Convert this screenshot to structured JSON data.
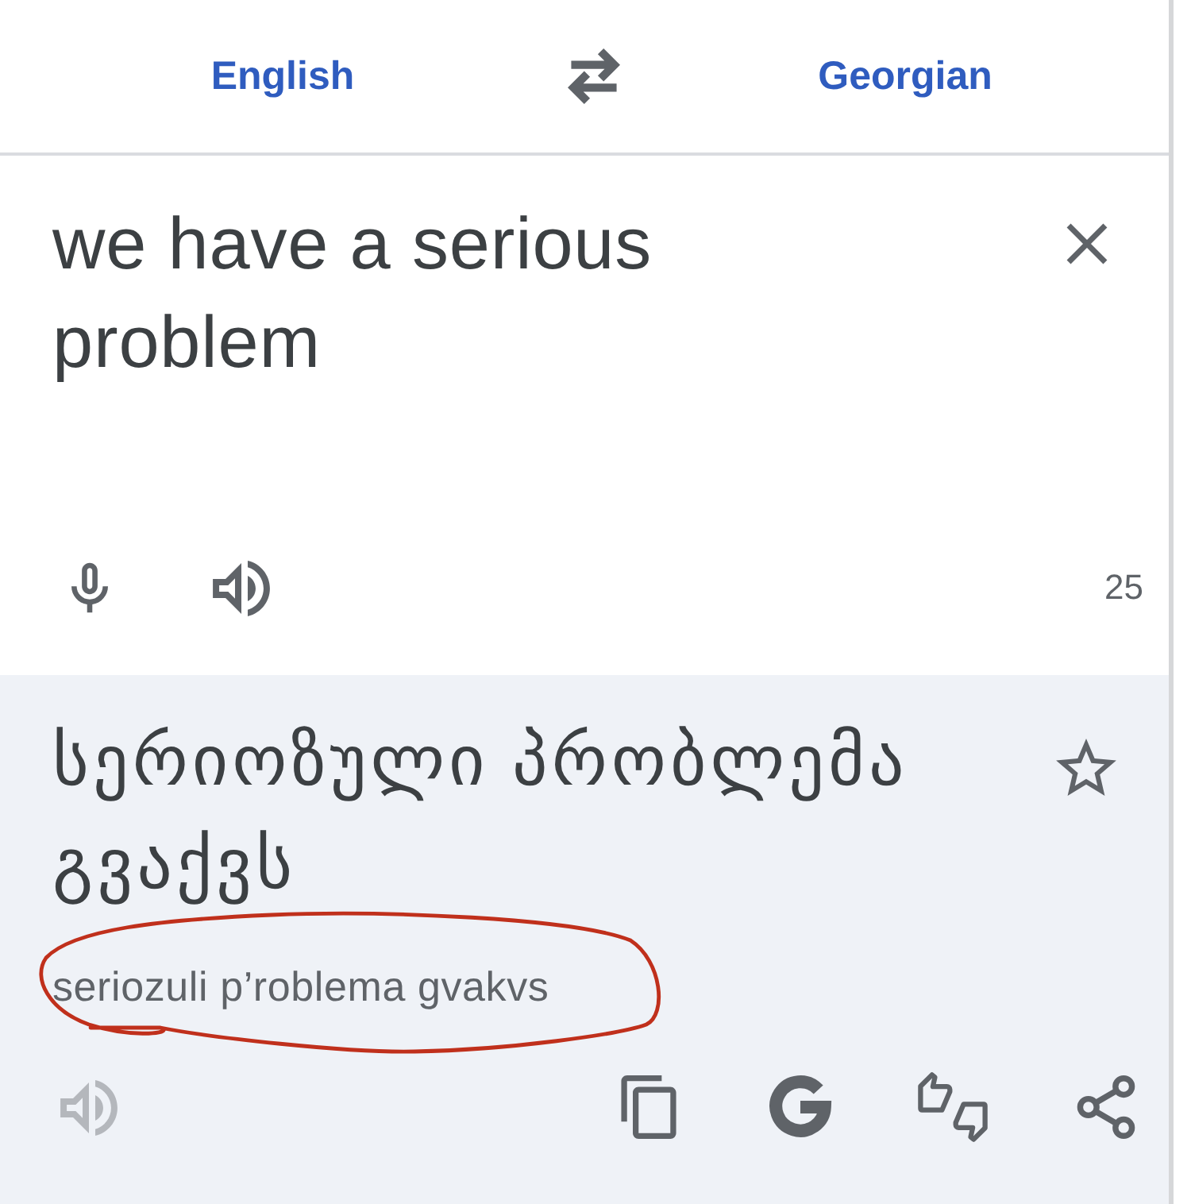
{
  "languages": {
    "source": "English",
    "target": "Georgian"
  },
  "input": {
    "value": "we have a serious problem",
    "char_count": "25"
  },
  "output": {
    "translation": "სერიოზული პრობლემა გვაქვს",
    "transliteration": "seriozuli p’roblema gvakvs",
    "transliteration_circled": true,
    "starred": false,
    "listen_disabled": true
  }
}
